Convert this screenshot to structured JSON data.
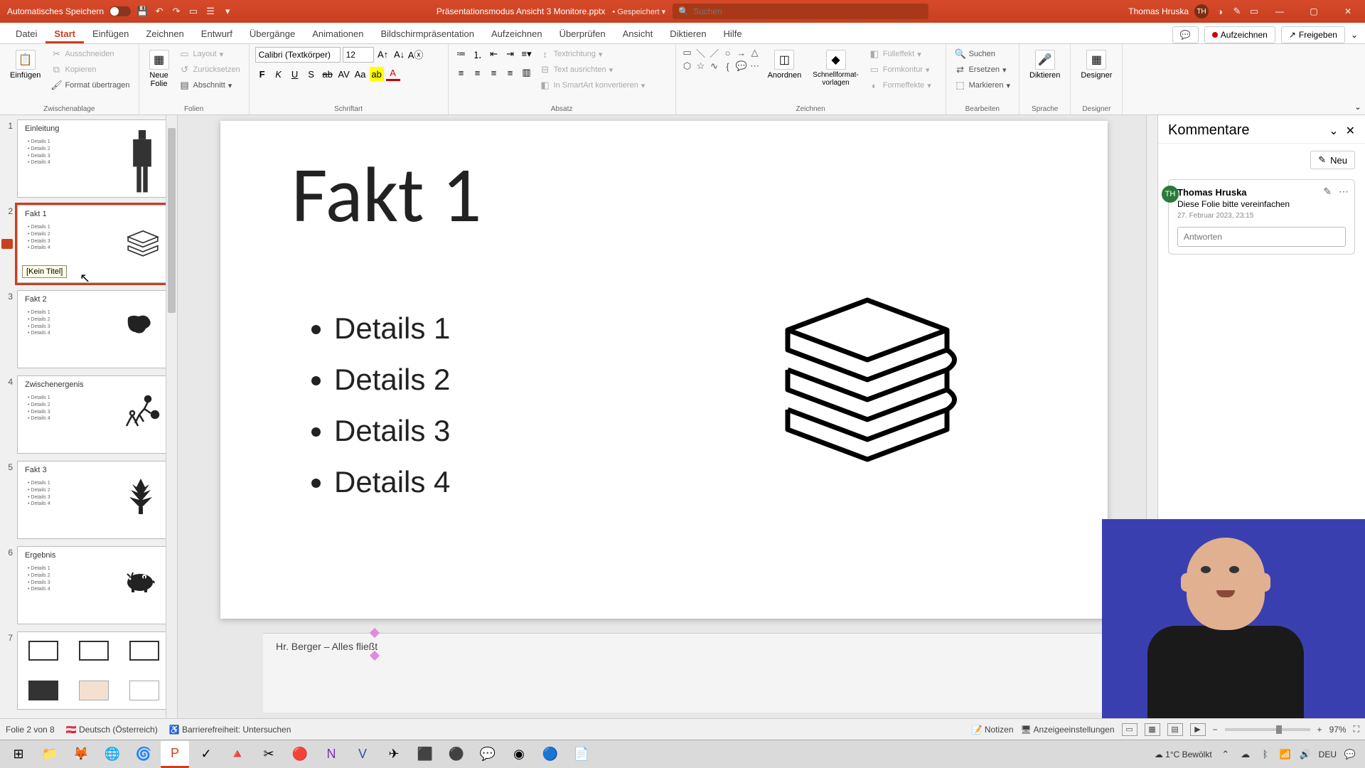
{
  "titlebar": {
    "autosave_label": "Automatisches Speichern",
    "doc_title": "Präsentationsmodus Ansicht 3 Monitore.pptx",
    "saved_label": "• Gespeichert ▾",
    "search_placeholder": "Suchen",
    "user_name": "Thomas Hruska",
    "user_initials": "TH"
  },
  "tabs": {
    "items": [
      "Datei",
      "Start",
      "Einfügen",
      "Zeichnen",
      "Entwurf",
      "Übergänge",
      "Animationen",
      "Bildschirmpräsentation",
      "Aufzeichnen",
      "Überprüfen",
      "Ansicht",
      "Diktieren",
      "Hilfe"
    ],
    "active_index": 1,
    "record_btn": "Aufzeichnen",
    "share_btn": "Freigeben"
  },
  "ribbon": {
    "clipboard": {
      "paste": "Einfügen",
      "cut": "Ausschneiden",
      "copy": "Kopieren",
      "format_painter": "Format übertragen",
      "label": "Zwischenablage"
    },
    "slides": {
      "new_slide": "Neue\nFolie",
      "layout": "Layout",
      "reset": "Zurücksetzen",
      "section": "Abschnitt",
      "label": "Folien"
    },
    "font": {
      "name": "Calibri (Textkörper)",
      "size": "12",
      "label": "Schriftart"
    },
    "paragraph": {
      "text_dir": "Textrichtung",
      "align_text": "Text ausrichten",
      "smartart": "In SmartArt konvertieren",
      "label": "Absatz"
    },
    "drawing": {
      "arrange": "Anordnen",
      "quick_styles": "Schnellformat-\nvorlagen",
      "shape_fill": "Fülleffekt",
      "shape_outline": "Formkontur",
      "shape_effects": "Formeffekte",
      "label": "Zeichnen"
    },
    "editing": {
      "find": "Suchen",
      "replace": "Ersetzen",
      "select": "Markieren",
      "label": "Bearbeiten"
    },
    "voice": {
      "dictate": "Diktieren",
      "label": "Sprache"
    },
    "designer": {
      "label": "Designer",
      "btn": "Designer"
    }
  },
  "thumbnails": [
    {
      "num": "1",
      "title": "Einleitung",
      "bullets": [
        "Details 1",
        "Details 2",
        "Details 3",
        "Details 4"
      ]
    },
    {
      "num": "2",
      "title": "Fakt 1",
      "bullets": [
        "Details 1",
        "Details 2",
        "Details 3",
        "Details 4"
      ],
      "tooltip": "[Kein Titel]",
      "selected": true,
      "has_comment": true
    },
    {
      "num": "3",
      "title": "Fakt 2",
      "bullets": [
        "Details 1",
        "Details 2",
        "Details 3",
        "Details 4"
      ]
    },
    {
      "num": "4",
      "title": "Zwischenergenis",
      "bullets": [
        "Details 1",
        "Details 2",
        "Details 3",
        "Details 4"
      ]
    },
    {
      "num": "5",
      "title": "Fakt 3",
      "bullets": [
        "Details 1",
        "Details 2",
        "Details 3",
        "Details 4"
      ]
    },
    {
      "num": "6",
      "title": "Ergebnis",
      "bullets": [
        "Details 1",
        "Details 2",
        "Details 3",
        "Details 4"
      ]
    },
    {
      "num": "7",
      "title": ""
    }
  ],
  "slide": {
    "heading": "Fakt 1",
    "bullets": [
      "Details 1",
      "Details 2",
      "Details 3",
      "Details 4"
    ],
    "notes": "Hr. Berger – Alles fließt"
  },
  "comments": {
    "title": "Kommentare",
    "new_btn": "Neu",
    "items": [
      {
        "initials": "TH",
        "author": "Thomas Hruska",
        "text": "Diese Folie bitte vereinfachen",
        "date": "27. Februar 2023, 23:15"
      }
    ],
    "reply_placeholder": "Antworten"
  },
  "statusbar": {
    "slide_pos": "Folie 2 von 8",
    "language": "Deutsch (Österreich)",
    "accessibility": "Barrierefreiheit: Untersuchen",
    "notes_btn": "Notizen",
    "display_settings": "Anzeigeeinstellungen",
    "zoom": "97%"
  },
  "taskbar": {
    "weather": "1°C  Bewölkt",
    "lang": "DEU"
  }
}
